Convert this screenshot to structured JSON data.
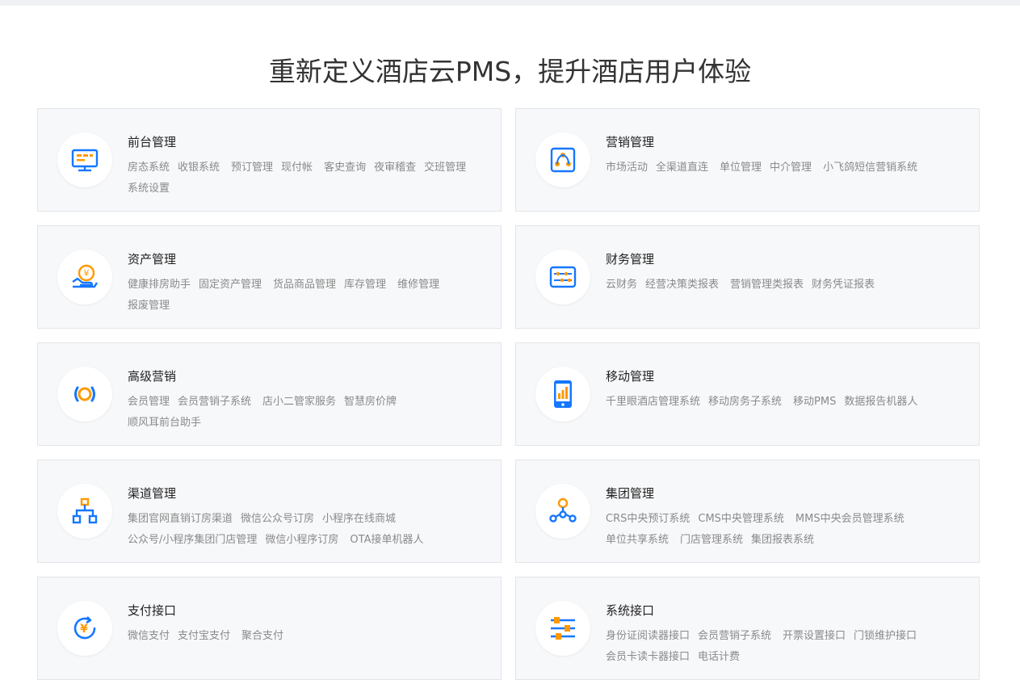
{
  "page_title": "重新定义酒店云PMS，提升酒店用户体验",
  "colors": {
    "blue": "#1677ff",
    "orange": "#ff9900",
    "card_bg": "#f7f8fa",
    "border": "#e3e5e9"
  },
  "cards": [
    {
      "title": "前台管理",
      "icon": "monitor-icon",
      "items": [
        "房态系统",
        "收银系统",
        "预订管理",
        "现付帐",
        "客史查询",
        "夜审稽查",
        "交班管理",
        "系统设置"
      ]
    },
    {
      "title": "营销管理",
      "icon": "share-nodes-icon",
      "items": [
        "市场活动",
        "全渠道直连",
        "单位管理",
        "中介管理",
        "小飞鸽短信营销系统"
      ]
    },
    {
      "title": "资产管理",
      "icon": "hand-coin-icon",
      "items": [
        "健康排房助手",
        "固定资产管理",
        "货品商品管理",
        "库存管理",
        "维修管理",
        "报废管理"
      ]
    },
    {
      "title": "财务管理",
      "icon": "finance-panel-icon",
      "items": [
        "云财务",
        "经营决策类报表",
        "营销管理类报表",
        "财务凭证报表"
      ]
    },
    {
      "title": "高级营销",
      "icon": "signal-broadcast-icon",
      "items": [
        "会员管理",
        "会员营销子系统",
        "店小二管家服务",
        "智慧房价牌",
        "顺风耳前台助手"
      ]
    },
    {
      "title": "移动管理",
      "icon": "mobile-chart-icon",
      "items": [
        "千里眼酒店管理系统",
        "移动房务子系统",
        "移动PMS",
        "数据报告机器人"
      ]
    },
    {
      "title": "渠道管理",
      "icon": "org-tree-icon",
      "items": [
        "集团官网直销订房渠道",
        "微信公众号订房",
        "小程序在线商城",
        "公众号/小程序集团门店管理",
        "微信小程序订房",
        "OTA接单机器人"
      ]
    },
    {
      "title": "集团管理",
      "icon": "network-nodes-icon",
      "items": [
        "CRS中央预订系统",
        "CMS中央管理系统",
        "MMS中央会员管理系统",
        "单位共享系统",
        "门店管理系统",
        "集团报表系统"
      ]
    },
    {
      "title": "支付接口",
      "icon": "yen-refresh-icon",
      "items": [
        "微信支付",
        "支付宝支付",
        "聚合支付"
      ]
    },
    {
      "title": "系统接口",
      "icon": "sliders-icon",
      "items": [
        "身份证阅读器接口",
        "会员营销子系统",
        "开票设置接口",
        "门锁维护接口",
        "会员卡读卡器接口",
        "电话计费"
      ]
    }
  ]
}
